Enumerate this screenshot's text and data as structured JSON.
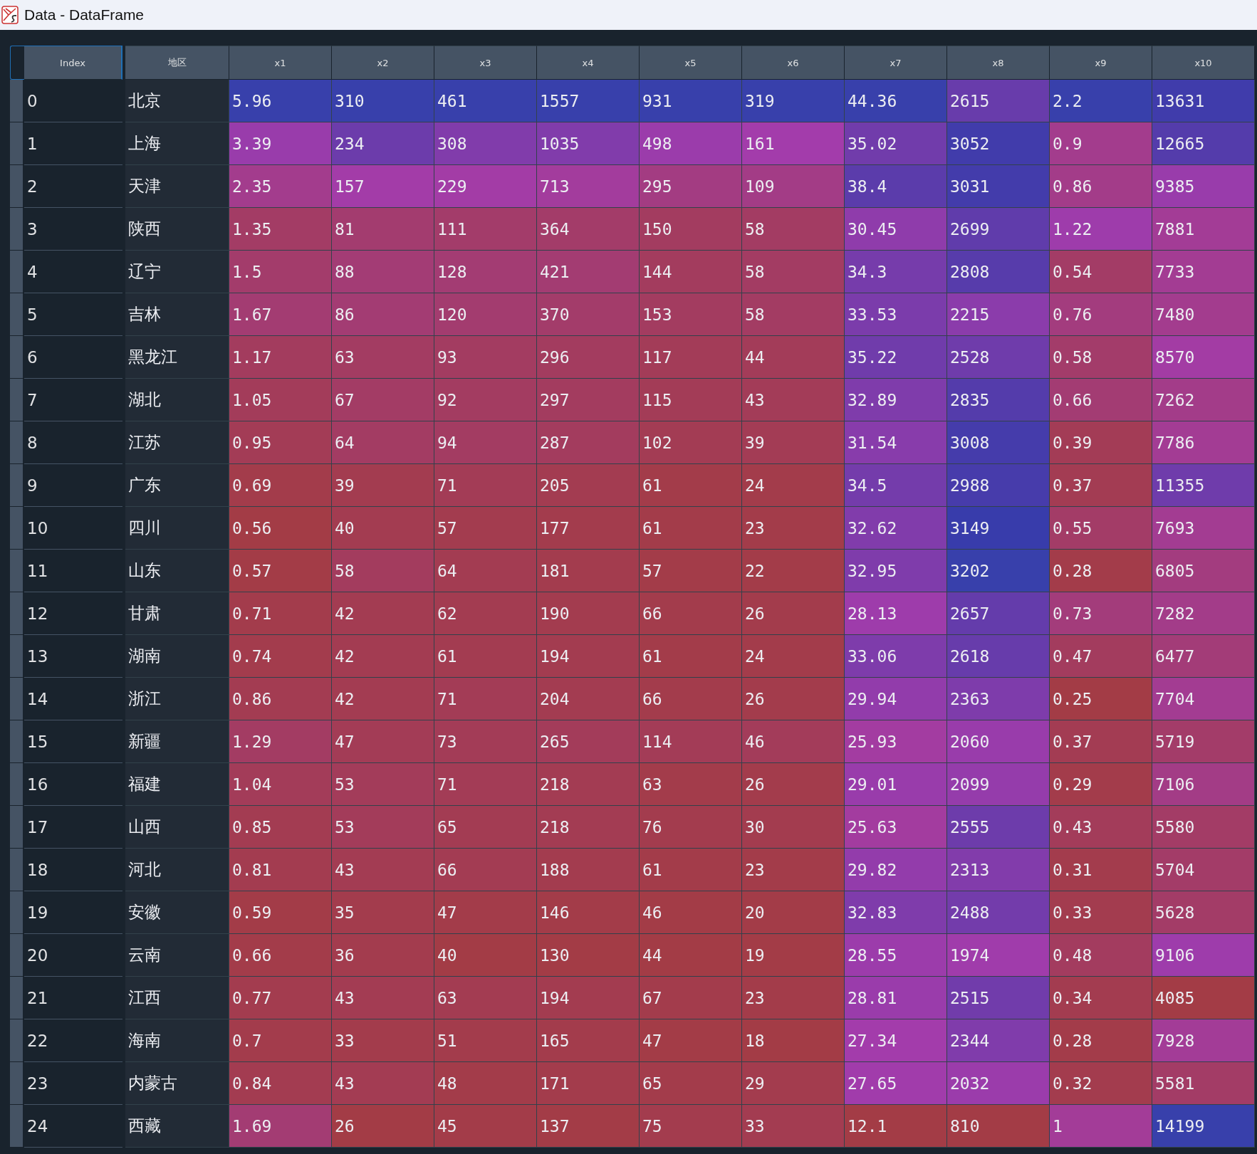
{
  "window": {
    "title": "Data - DataFrame"
  },
  "table": {
    "index_header": "Index",
    "columns": [
      "地区",
      "x1",
      "x2",
      "x3",
      "x4",
      "x5",
      "x6",
      "x7",
      "x8",
      "x9",
      "x10"
    ],
    "rows": [
      {
        "index": "0",
        "cells": [
          "北京",
          "5.96",
          "310",
          "461",
          "1557",
          "931",
          "319",
          "44.36",
          "2615",
          "2.2",
          "13631"
        ]
      },
      {
        "index": "1",
        "cells": [
          "上海",
          "3.39",
          "234",
          "308",
          "1035",
          "498",
          "161",
          "35.02",
          "3052",
          "0.9",
          "12665"
        ]
      },
      {
        "index": "2",
        "cells": [
          "天津",
          "2.35",
          "157",
          "229",
          "713",
          "295",
          "109",
          "38.4",
          "3031",
          "0.86",
          "9385"
        ]
      },
      {
        "index": "3",
        "cells": [
          "陕西",
          "1.35",
          "81",
          "111",
          "364",
          "150",
          "58",
          "30.45",
          "2699",
          "1.22",
          "7881"
        ]
      },
      {
        "index": "4",
        "cells": [
          "辽宁",
          "1.5",
          "88",
          "128",
          "421",
          "144",
          "58",
          "34.3",
          "2808",
          "0.54",
          "7733"
        ]
      },
      {
        "index": "5",
        "cells": [
          "吉林",
          "1.67",
          "86",
          "120",
          "370",
          "153",
          "58",
          "33.53",
          "2215",
          "0.76",
          "7480"
        ]
      },
      {
        "index": "6",
        "cells": [
          "黑龙江",
          "1.17",
          "63",
          "93",
          "296",
          "117",
          "44",
          "35.22",
          "2528",
          "0.58",
          "8570"
        ]
      },
      {
        "index": "7",
        "cells": [
          "湖北",
          "1.05",
          "67",
          "92",
          "297",
          "115",
          "43",
          "32.89",
          "2835",
          "0.66",
          "7262"
        ]
      },
      {
        "index": "8",
        "cells": [
          "江苏",
          "0.95",
          "64",
          "94",
          "287",
          "102",
          "39",
          "31.54",
          "3008",
          "0.39",
          "7786"
        ]
      },
      {
        "index": "9",
        "cells": [
          "广东",
          "0.69",
          "39",
          "71",
          "205",
          "61",
          "24",
          "34.5",
          "2988",
          "0.37",
          "11355"
        ]
      },
      {
        "index": "10",
        "cells": [
          "四川",
          "0.56",
          "40",
          "57",
          "177",
          "61",
          "23",
          "32.62",
          "3149",
          "0.55",
          "7693"
        ]
      },
      {
        "index": "11",
        "cells": [
          "山东",
          "0.57",
          "58",
          "64",
          "181",
          "57",
          "22",
          "32.95",
          "3202",
          "0.28",
          "6805"
        ]
      },
      {
        "index": "12",
        "cells": [
          "甘肃",
          "0.71",
          "42",
          "62",
          "190",
          "66",
          "26",
          "28.13",
          "2657",
          "0.73",
          "7282"
        ]
      },
      {
        "index": "13",
        "cells": [
          "湖南",
          "0.74",
          "42",
          "61",
          "194",
          "61",
          "24",
          "33.06",
          "2618",
          "0.47",
          "6477"
        ]
      },
      {
        "index": "14",
        "cells": [
          "浙江",
          "0.86",
          "42",
          "71",
          "204",
          "66",
          "26",
          "29.94",
          "2363",
          "0.25",
          "7704"
        ]
      },
      {
        "index": "15",
        "cells": [
          "新疆",
          "1.29",
          "47",
          "73",
          "265",
          "114",
          "46",
          "25.93",
          "2060",
          "0.37",
          "5719"
        ]
      },
      {
        "index": "16",
        "cells": [
          "福建",
          "1.04",
          "53",
          "71",
          "218",
          "63",
          "26",
          "29.01",
          "2099",
          "0.29",
          "7106"
        ]
      },
      {
        "index": "17",
        "cells": [
          "山西",
          "0.85",
          "53",
          "65",
          "218",
          "76",
          "30",
          "25.63",
          "2555",
          "0.43",
          "5580"
        ]
      },
      {
        "index": "18",
        "cells": [
          "河北",
          "0.81",
          "43",
          "66",
          "188",
          "61",
          "23",
          "29.82",
          "2313",
          "0.31",
          "5704"
        ]
      },
      {
        "index": "19",
        "cells": [
          "安徽",
          "0.59",
          "35",
          "47",
          "146",
          "46",
          "20",
          "32.83",
          "2488",
          "0.33",
          "5628"
        ]
      },
      {
        "index": "20",
        "cells": [
          "云南",
          "0.66",
          "36",
          "40",
          "130",
          "44",
          "19",
          "28.55",
          "1974",
          "0.48",
          "9106"
        ]
      },
      {
        "index": "21",
        "cells": [
          "江西",
          "0.77",
          "43",
          "63",
          "194",
          "67",
          "23",
          "28.81",
          "2515",
          "0.34",
          "4085"
        ]
      },
      {
        "index": "22",
        "cells": [
          "海南",
          "0.7",
          "33",
          "51",
          "165",
          "47",
          "18",
          "27.34",
          "2344",
          "0.28",
          "7928"
        ]
      },
      {
        "index": "23",
        "cells": [
          "内蒙古",
          "0.84",
          "43",
          "48",
          "171",
          "65",
          "29",
          "27.65",
          "2032",
          "0.32",
          "5581"
        ]
      },
      {
        "index": "24",
        "cells": [
          "西藏",
          "1.69",
          "26",
          "45",
          "137",
          "75",
          "33",
          "12.1",
          "810",
          "1",
          "14199"
        ]
      }
    ]
  }
}
